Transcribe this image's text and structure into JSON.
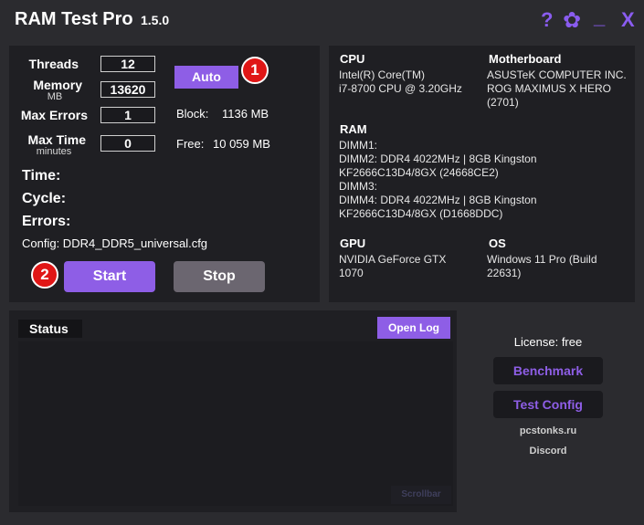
{
  "app": {
    "title": "RAM Test Pro",
    "version": "1.5.0",
    "icons": {
      "help": "?",
      "settings": "✿",
      "minimize": "_",
      "close": "X"
    }
  },
  "settings": {
    "threads_label": "Threads",
    "threads_value": "12",
    "memory_label": "Memory",
    "memory_unit": "MB",
    "memory_value": "13620",
    "max_errors_label": "Max Errors",
    "max_errors_value": "1",
    "max_time_label": "Max Time",
    "max_time_unit": "minutes",
    "max_time_value": "0",
    "auto_button": "Auto",
    "block_label": "Block:",
    "block_value": "1136 MB",
    "free_label": "Free:",
    "free_value": "10 059 MB"
  },
  "stats": {
    "time_label": "Time:",
    "cycle_label": "Cycle:",
    "errors_label": "Errors:",
    "config_label": "Config: DDR4_DDR5_universal.cfg"
  },
  "actions": {
    "start_label": "Start",
    "stop_label": "Stop"
  },
  "badges": {
    "one": "1",
    "two": "2"
  },
  "system": {
    "cpu_label": "CPU",
    "cpu_line1": "Intel(R) Core(TM)",
    "cpu_line2": "i7-8700 CPU @ 3.20GHz",
    "mb_label": "Motherboard",
    "mb_line1": "ASUSTeK COMPUTER INC.",
    "mb_line2": "ROG MAXIMUS X HERO",
    "mb_line3": "(2701)",
    "ram_label": "RAM",
    "ram_line1": "DIMM1:",
    "ram_line2": "DIMM2: DDR4 4022MHz | 8GB Kingston",
    "ram_line3": "KF2666C13D4/8GX (24668CE2)",
    "ram_line4": "DIMM3:",
    "ram_line5": "DIMM4: DDR4 4022MHz | 8GB Kingston",
    "ram_line6": "KF2666C13D4/8GX (D1668DDC)",
    "gpu_label": "GPU",
    "gpu_line1": "NVIDIA GeForce GTX",
    "gpu_line2": "1070",
    "os_label": "OS",
    "os_line1": "Windows 11 Pro (Build",
    "os_line2": "22631)"
  },
  "status": {
    "title": "Status",
    "open_log": "Open Log",
    "scrollbar": "Scrollbar"
  },
  "side": {
    "license": "License: free",
    "benchmark": "Benchmark",
    "test_config": "Test Config",
    "site": "pcstonks.ru",
    "discord": "Discord"
  },
  "colors": {
    "accent": "#8e5ee6",
    "badge": "#e01616",
    "background": "#2b2b2f",
    "panel": "#1f1f23"
  }
}
